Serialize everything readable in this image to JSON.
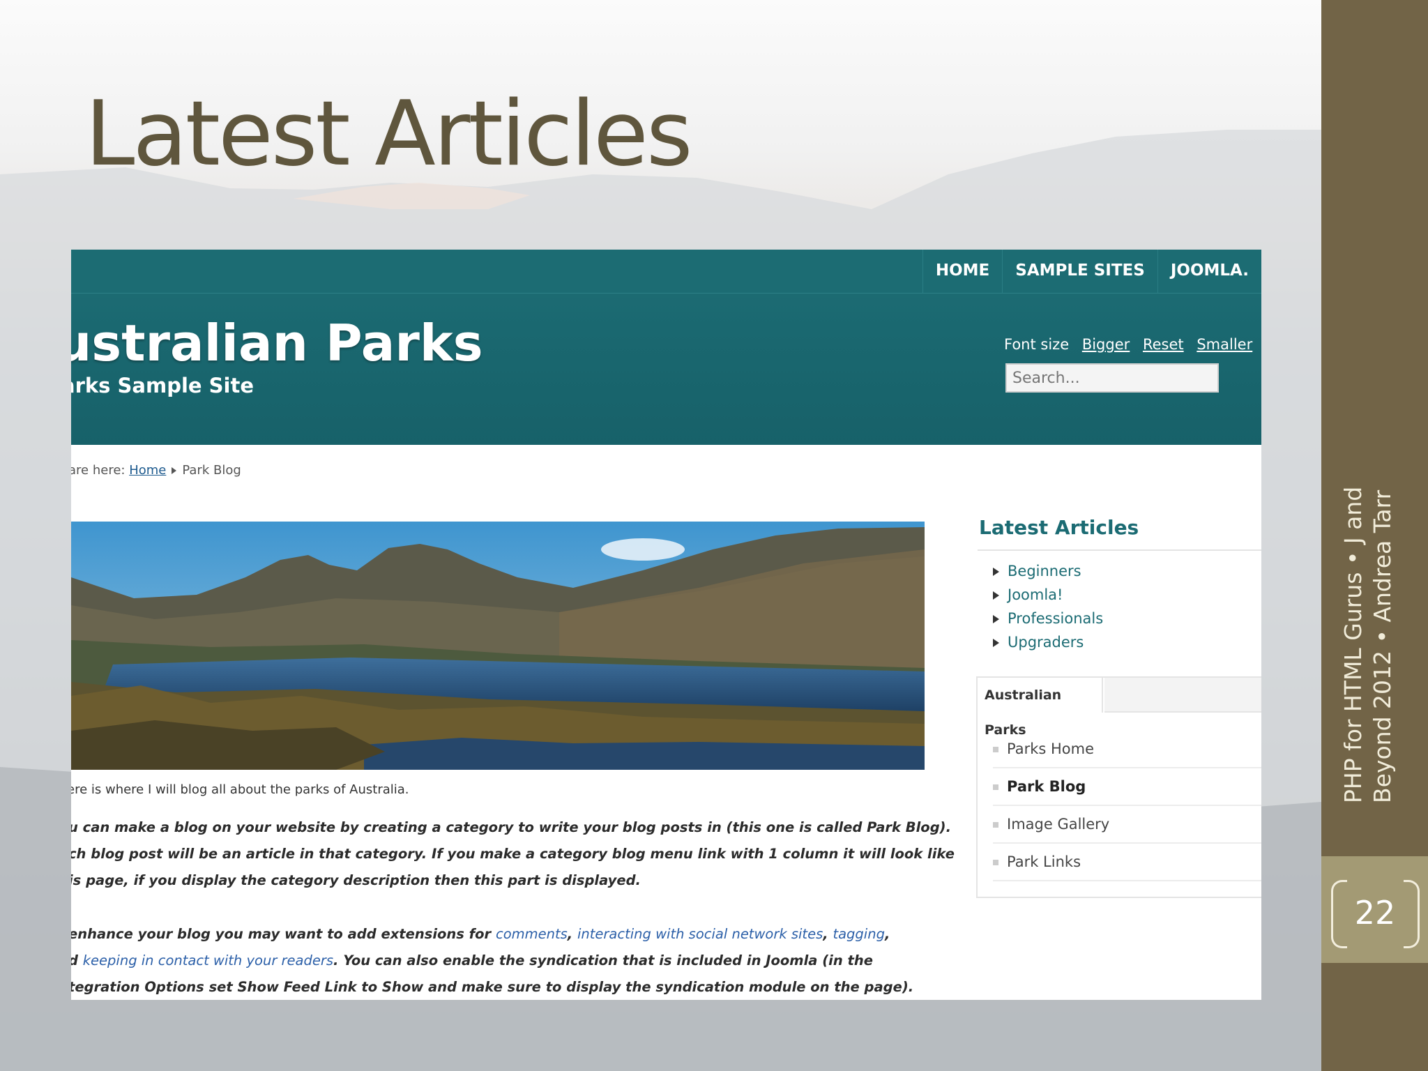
{
  "slide": {
    "title": "Latest Articles",
    "footer_line1": "PHP for HTML Gurus • J and",
    "footer_line2": "Beyond 2012 • Andrea Tarr",
    "page_number": "22"
  },
  "site": {
    "nav": [
      "HOME",
      "SAMPLE SITES",
      "JOOMLA."
    ],
    "title": "ustralian Parks",
    "subtitle": "arks Sample Site",
    "font_size_label": "Font size",
    "font_size_links": [
      "Bigger",
      "Reset",
      "Smaller"
    ],
    "search_placeholder": "Search...",
    "breadcrumb": {
      "prefix": "are here:",
      "home": "Home",
      "current": "Park Blog"
    },
    "intro": "ere is where I will blog all about the parks of Australia.",
    "para1_lines": [
      "u can make a blog on your website by creating a category to write your blog posts in (this one is called Park Blog).",
      "ch blog post will be an article in that category. If you make a category blog menu link with 1 column it will look like",
      "is page, if you display the category description then this part is displayed."
    ],
    "para2": {
      "l1_a": "enhance your blog you may want to add extensions for ",
      "link_comments": "comments",
      "sep1": ", ",
      "link_social": "interacting with social network sites",
      "sep2": ", ",
      "link_tagging": "tagging",
      "sep3": ",",
      "l2_a": "d ",
      "link_contact": "keeping in contact with your readers",
      "l2_b": ". You can also enable the syndication that is included in Joomla (in the",
      "l3": "tegration Options set Show Feed Link to Show and make sure to display the syndication module on the page)."
    },
    "latest_articles": {
      "title": "Latest Articles",
      "items": [
        "Beginners",
        "Joomla!",
        "Professionals",
        "Upgraders"
      ]
    },
    "parks_menu": {
      "tab": "Australian Parks",
      "items": [
        "Parks Home",
        "Park Blog",
        "Image Gallery",
        "Park Links"
      ],
      "active": "Park Blog"
    }
  }
}
